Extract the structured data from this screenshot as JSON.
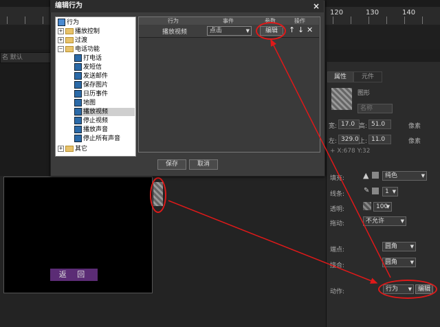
{
  "ruler": {
    "labels": [
      "120",
      "130",
      "140"
    ]
  },
  "name_field": {
    "value": "名 默认"
  },
  "preview": {
    "back_button": "返 回"
  },
  "properties": {
    "tabs": [
      "属性",
      "元件"
    ],
    "shape_label": "图形",
    "name_placeholder": "名称",
    "width_label": "宽:",
    "width_value": "17.0",
    "height_label": "高:",
    "height_value": "51.0",
    "unit": "像素",
    "left_label": "左:",
    "left_value": "329.0",
    "top_label": "上:",
    "top_value": "11.0",
    "coords": "+ X:678   Y:32",
    "fill_label": "填充:",
    "fill_value": "纯色",
    "stroke_label": "线条:",
    "stroke_value": "1",
    "opacity_label": "透明:",
    "opacity_value": "100",
    "drag_label": "拖动:",
    "drag_value": "不允许",
    "endpoint_label": "端点:",
    "endpoint_value": "圆角",
    "join_label": "接合:",
    "join_value": "圆角",
    "action_label": "动作:",
    "action_value": "行为",
    "action_edit": "编辑"
  },
  "dialog": {
    "title": "编辑行为",
    "close": "×",
    "tree": {
      "root": "行为",
      "items": [
        {
          "label": "播放控制",
          "type": "folder",
          "expand": "+"
        },
        {
          "label": "过渡",
          "type": "folder",
          "expand": "+"
        },
        {
          "label": "电话功能",
          "type": "folder",
          "expand": "−"
        },
        {
          "label": "打电话",
          "type": "leaf"
        },
        {
          "label": "发短信",
          "type": "leaf"
        },
        {
          "label": "发送邮件",
          "type": "leaf"
        },
        {
          "label": "保存图片",
          "type": "leaf"
        },
        {
          "label": "日历事件",
          "type": "leaf"
        },
        {
          "label": "地图",
          "type": "leaf"
        },
        {
          "label": "播放视频",
          "type": "leaf",
          "selected": true
        },
        {
          "label": "停止视频",
          "type": "leaf"
        },
        {
          "label": "播放声音",
          "type": "leaf"
        },
        {
          "label": "停止所有声音",
          "type": "leaf"
        },
        {
          "label": "其它",
          "type": "folder",
          "expand": "+"
        }
      ]
    },
    "grid": {
      "headers": [
        "行为",
        "事件",
        "参数",
        "操作"
      ],
      "row": {
        "behavior": "播放视频",
        "event": "点击",
        "param": "编辑"
      }
    },
    "save": "保存",
    "cancel": "取消"
  },
  "colors": {
    "annotation": "#e01919",
    "back_button": "#5b2c75"
  }
}
